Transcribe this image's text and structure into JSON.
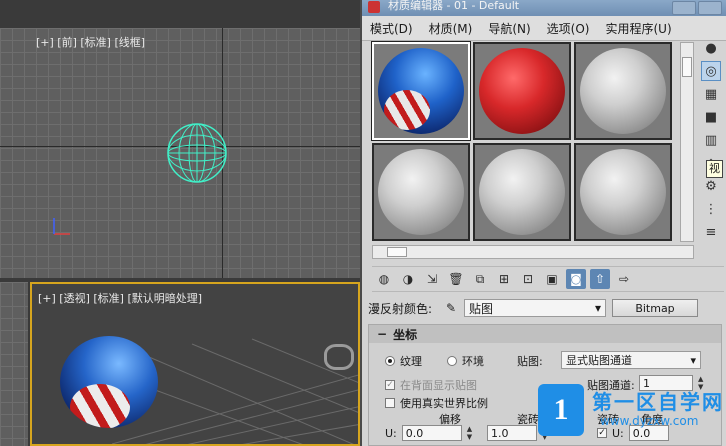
{
  "viewports": {
    "front": {
      "label": "[+] [前] [标准] [线框]"
    },
    "perspective": {
      "label": "[+] [透视] [标准] [默认明暗处理]"
    }
  },
  "material_editor": {
    "title": "材质编辑器 - 01 - Default",
    "menu": [
      "模式(D)",
      "材质(M)",
      "导航(N)",
      "选项(O)",
      "实用程序(U)"
    ],
    "slots": [
      {
        "kind": "textured",
        "active": true
      },
      {
        "kind": "red",
        "active": false
      },
      {
        "kind": "gray",
        "active": false
      },
      {
        "kind": "gray",
        "active": false
      },
      {
        "kind": "gray",
        "active": false
      },
      {
        "kind": "gray",
        "active": false
      }
    ],
    "tooltip": "视",
    "diffuse": {
      "label": "漫反射颜色:",
      "dropdown": "贴图",
      "map_button": "Bitmap"
    },
    "rollout": {
      "title": "坐标",
      "texture_label": "纹理",
      "environment_label": "环境",
      "mapping_label": "贴图:",
      "mapping_value": "显式贴图通道",
      "show_on_back": "在背面显示贴图",
      "map_channel_label": "贴图通道:",
      "map_channel_value": "1",
      "real_world": "使用真实世界比例",
      "offset_header": "偏移",
      "tiling_header": "瓷砖",
      "mirror_header": "瓷砖",
      "angle_header": "角度",
      "u_label": "U:",
      "u_offset": "0.0",
      "u_tiling": "1.0",
      "angle_u_label": "U:",
      "angle_u_value": "0.0"
    }
  },
  "watermark": {
    "title": "第一区自学网",
    "url": "www.dyzxw.com",
    "glyph": "1"
  },
  "colors": {
    "selection": "#40f0c8",
    "active_viewport": "#d6a51e",
    "accent_blue": "#1f8ee6"
  }
}
